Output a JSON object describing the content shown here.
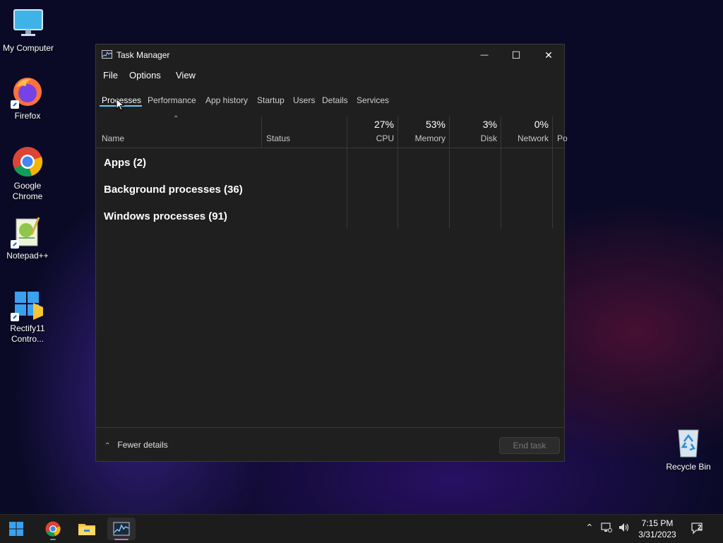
{
  "desktop": {
    "icons": [
      {
        "label": "My Computer",
        "icon": "monitor-icon"
      },
      {
        "label": "Firefox",
        "icon": "firefox-icon"
      },
      {
        "label": "Google Chrome",
        "icon": "chrome-icon"
      },
      {
        "label": "Notepad++",
        "icon": "notepadpp-icon"
      },
      {
        "label": "Rectify11 Contro...",
        "icon": "rectify11-icon"
      },
      {
        "label": "Recycle Bin",
        "icon": "recycle-bin-icon"
      }
    ]
  },
  "window": {
    "title": "Task Manager",
    "controls": {
      "minimize": "—",
      "maximize": "☐",
      "close": "✕"
    },
    "menu": [
      "File",
      "Options",
      "View"
    ],
    "tabs": [
      "Processes",
      "Performance",
      "App history",
      "Startup",
      "Users",
      "Details",
      "Services"
    ],
    "active_tab": "Processes",
    "columns": {
      "name": "Name",
      "status": "Status",
      "cpu": {
        "label": "CPU",
        "value": "27%"
      },
      "memory": {
        "label": "Memory",
        "value": "53%"
      },
      "disk": {
        "label": "Disk",
        "value": "3%"
      },
      "network": {
        "label": "Network",
        "value": "0%"
      },
      "power": {
        "label": "Po"
      }
    },
    "groups": [
      "Apps (2)",
      "Background processes (36)",
      "Windows processes (91)"
    ],
    "footer": {
      "fewer_details": "Fewer details",
      "end_task": "End task"
    }
  },
  "taskbar": {
    "items": [
      "start-icon",
      "chrome-icon",
      "file-explorer-icon",
      "task-manager-icon"
    ],
    "active_item": "task-manager-icon",
    "time": "7:15 PM",
    "date": "3/31/2023",
    "notification_count": "2"
  },
  "colors": {
    "accent": "#60cdff",
    "active_indicator": "#c070e0",
    "window_bg": "#1f1f1f"
  }
}
